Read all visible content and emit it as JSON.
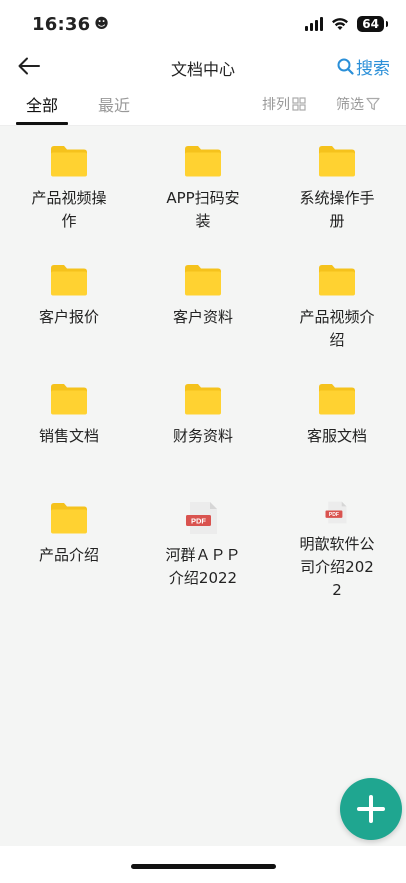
{
  "status_bar": {
    "time": "16:36",
    "emoji": "☻",
    "battery": "64"
  },
  "header": {
    "title": "文档中心",
    "search_label": "搜索"
  },
  "tabs": {
    "all": "全部",
    "recent": "最近",
    "sort": "排列",
    "filter": "筛选"
  },
  "files": [
    {
      "label": "产品视频操作",
      "type": "folder"
    },
    {
      "label": "APP扫码安装",
      "type": "folder"
    },
    {
      "label": "系统操作手册",
      "type": "folder"
    },
    {
      "label": "客户报价",
      "type": "folder"
    },
    {
      "label": "客户资料",
      "type": "folder"
    },
    {
      "label": "产品视频介绍",
      "type": "folder"
    },
    {
      "label": "销售文档",
      "type": "folder"
    },
    {
      "label": "财务资料",
      "type": "folder"
    },
    {
      "label": "客服文档",
      "type": "folder"
    },
    {
      "label": "产品介绍",
      "type": "folder"
    },
    {
      "label": "河群ＡＰＰ介绍2022",
      "type": "pdf"
    },
    {
      "label": "明歆软件公司介绍2022",
      "type": "pdf"
    }
  ],
  "pdf_badge": "PDF",
  "colors": {
    "folder": "#ffd231",
    "folder_tab": "#f5c21c",
    "accent": "#2a8fd8",
    "fab": "#1fa690",
    "pdf_red": "#d9534f"
  }
}
